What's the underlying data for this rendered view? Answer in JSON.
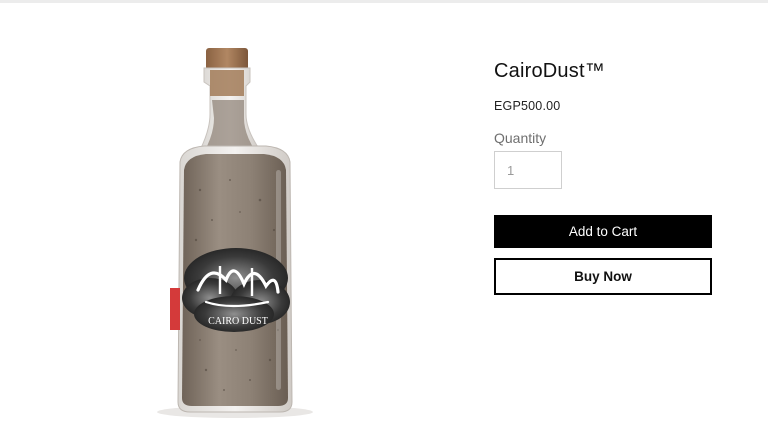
{
  "product": {
    "title": "CairoDust™",
    "price": "EGP500.00",
    "image_name": "sand-bottle-image",
    "label_arabic": "تراب القاهرة",
    "label_latin": "CAIRO DUST"
  },
  "quantity": {
    "label": "Quantity",
    "value": "1"
  },
  "buttons": {
    "add_to_cart": "Add to Cart",
    "buy_now": "Buy Now"
  },
  "colors": {
    "primary": "#000000",
    "background": "#ffffff",
    "muted_text": "#6f6f6f"
  }
}
